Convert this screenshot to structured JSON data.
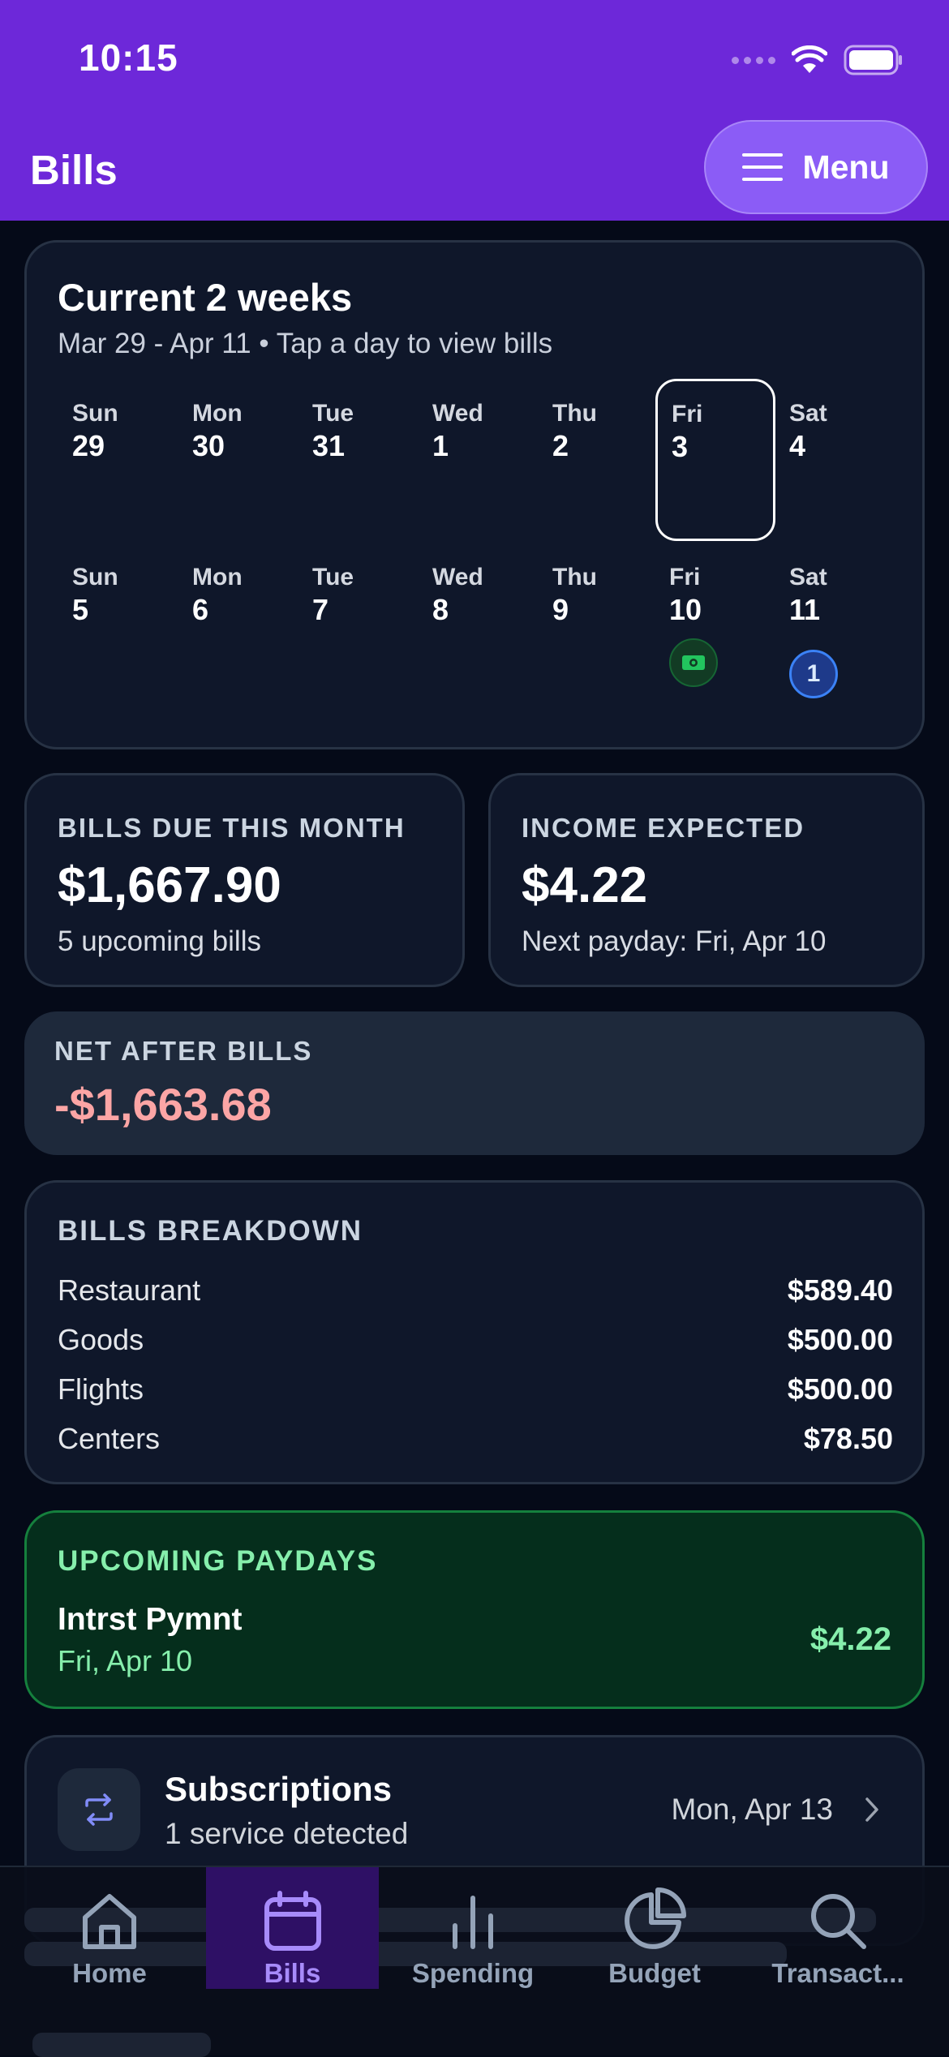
{
  "status_bar": {
    "time": "10:15"
  },
  "header": {
    "title": "Bills",
    "menu_label": "Menu"
  },
  "calendar": {
    "title": "Current 2 weeks",
    "subtitle": "Mar 29 - Apr 11 • Tap a day to view bills",
    "week1": [
      {
        "name": "Sun",
        "num": "29"
      },
      {
        "name": "Mon",
        "num": "30"
      },
      {
        "name": "Tue",
        "num": "31"
      },
      {
        "name": "Wed",
        "num": "1"
      },
      {
        "name": "Thu",
        "num": "2"
      },
      {
        "name": "Fri",
        "num": "3"
      },
      {
        "name": "Sat",
        "num": "4"
      }
    ],
    "week2": [
      {
        "name": "Sun",
        "num": "5"
      },
      {
        "name": "Mon",
        "num": "6"
      },
      {
        "name": "Tue",
        "num": "7"
      },
      {
        "name": "Wed",
        "num": "8"
      },
      {
        "name": "Thu",
        "num": "9"
      },
      {
        "name": "Fri",
        "num": "10"
      },
      {
        "name": "Sat",
        "num": "11"
      }
    ],
    "selected_day": "Fri 3",
    "sat11_bill_count": "1",
    "fri10_icon": "cash-icon"
  },
  "bills_due": {
    "label": "BILLS DUE THIS MONTH",
    "value": "$1,667.90",
    "sub": "5 upcoming bills"
  },
  "income": {
    "label": "INCOME EXPECTED",
    "value": "$4.22",
    "sub": "Next payday: Fri, Apr 10"
  },
  "net": {
    "label": "NET AFTER BILLS",
    "value": "-$1,663.68"
  },
  "breakdown": {
    "label": "BILLS BREAKDOWN",
    "rows": [
      {
        "name": "Restaurant",
        "amount": "$589.40"
      },
      {
        "name": "Goods",
        "amount": "$500.00"
      },
      {
        "name": "Flights",
        "amount": "$500.00"
      },
      {
        "name": "Centers",
        "amount": "$78.50"
      }
    ]
  },
  "paydays": {
    "label": "UPCOMING PAYDAYS",
    "name": "Intrst Pymnt",
    "date": "Fri, Apr 10",
    "amount": "$4.22"
  },
  "subscriptions": {
    "title": "Subscriptions",
    "sub": "1 service detected",
    "date": "Mon, Apr 13"
  },
  "tabs": [
    {
      "label": "Home",
      "icon": "home-icon"
    },
    {
      "label": "Bills",
      "icon": "calendar-icon",
      "active": true
    },
    {
      "label": "Spending",
      "icon": "bar-chart-icon"
    },
    {
      "label": "Budget",
      "icon": "pie-chart-icon"
    },
    {
      "label": "Transact...",
      "icon": "search-icon"
    }
  ],
  "colors": {
    "header": "#6d28d9",
    "accent": "#a78bfa",
    "negative": "#fca5a5",
    "positive": "#86efac"
  }
}
